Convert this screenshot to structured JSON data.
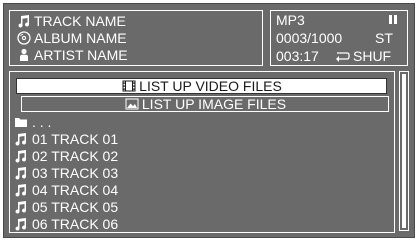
{
  "info": {
    "track_name": "TRACK NAME",
    "album_name": "ALBUM NAME",
    "artist_name": "ARTIST NAME",
    "icons": [
      "music-note-icon",
      "disc-icon",
      "person-icon"
    ]
  },
  "status": {
    "format": "MP3",
    "track_counter": "0003/1000",
    "stereo": "ST",
    "time": "003:17",
    "repeat_mode": "SHUF",
    "play_state_icon": "pause-icon"
  },
  "list": {
    "video_button": "LIST UP VIDEO FILES",
    "image_button": "LIST UP IMAGE FILES",
    "parent_folder": ". . .",
    "tracks": [
      "01 TRACK 01",
      "02 TRACK 02",
      "03 TRACK 03",
      "04 TRACK 04",
      "05 TRACK 05",
      "06 TRACK 06"
    ]
  },
  "colors": {
    "background": "#6a6a6a",
    "foreground": "#ffffff",
    "highlight_bg": "#ffffff",
    "highlight_text": "#1a1a1a"
  }
}
